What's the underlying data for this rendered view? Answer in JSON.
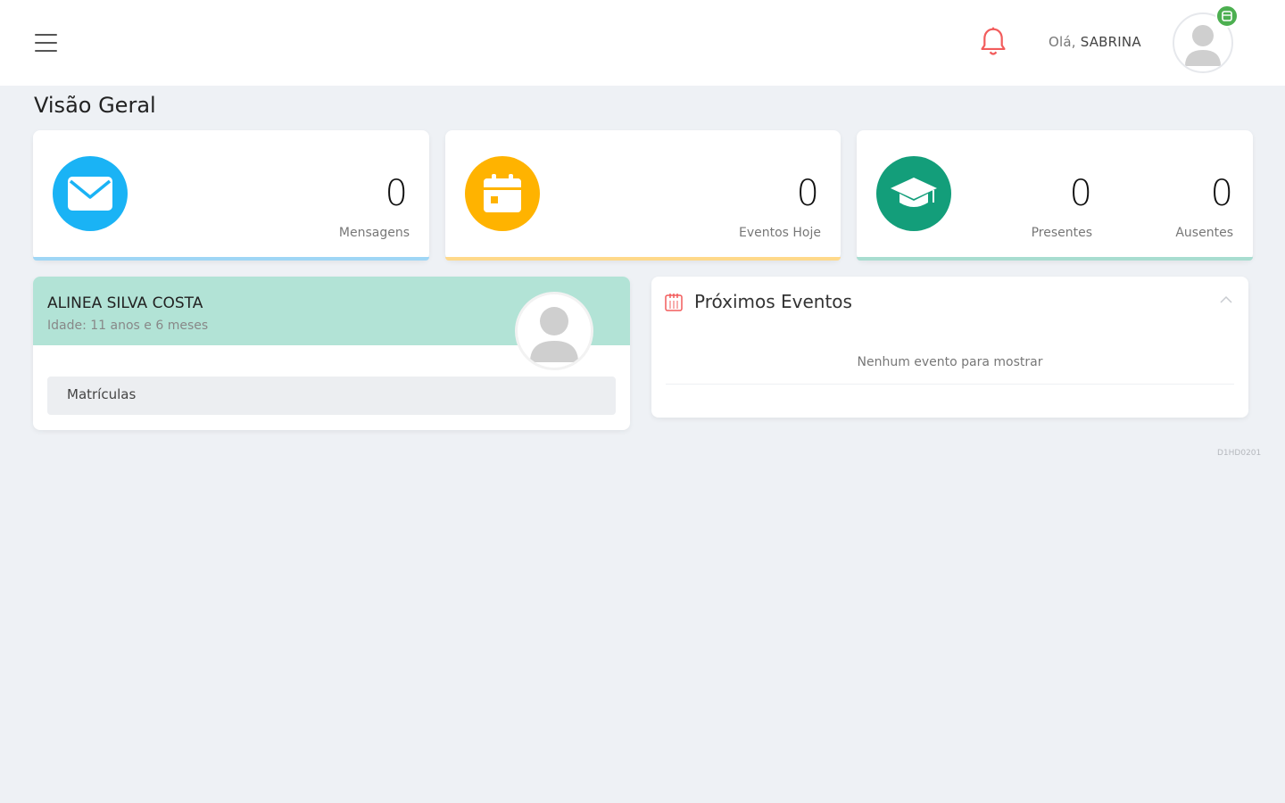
{
  "header": {
    "greeting_prefix": "Olá,",
    "user_name": "SABRINA",
    "icons": [
      "menu-icon",
      "bell-icon",
      "user-avatar-icon",
      "status-badge-icon"
    ],
    "colors": {
      "bell": "#f25c5c",
      "status": "#4caf50"
    }
  },
  "page": {
    "title": "Visão Geral"
  },
  "stats": {
    "messages": {
      "value": "0",
      "label": "Mensagens",
      "icon": "envelope-icon",
      "color": "#1ab3f5",
      "accent": "#9fd6f5"
    },
    "events_today": {
      "value": "0",
      "label": "Eventos Hoje",
      "icon": "calendar-icon",
      "color": "#ffb300",
      "accent": "#ffd98a"
    },
    "attendance": {
      "icon": "graduation-cap-icon",
      "color": "#139e7a",
      "accent": "#a8ddd0",
      "present_value": "0",
      "present_label": "Presentes",
      "absent_value": "0",
      "absent_label": "Ausentes"
    }
  },
  "student": {
    "name": "ALINEA SILVA COSTA",
    "age": "Idade: 11 anos e 6 meses",
    "enrollments_label": "Matrículas",
    "header_color": "#b2e3d6"
  },
  "events": {
    "title": "Próximos Eventos",
    "empty_message": "Nenhum evento para mostrar",
    "icon": "calendar-grid-icon"
  },
  "footer": {
    "version": "D1HD0201"
  }
}
